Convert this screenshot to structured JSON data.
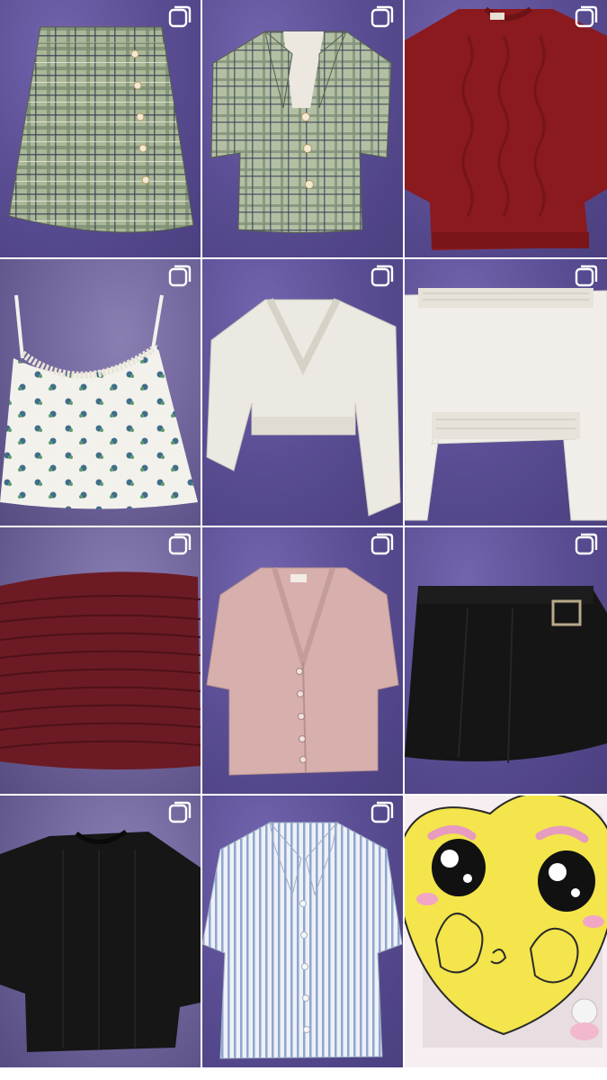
{
  "feed": {
    "posts": [
      {
        "name": "green-plaid-skirt-post",
        "icon": "multiple-photos-icon"
      },
      {
        "name": "green-plaid-shirt-post",
        "icon": "multiple-photos-icon"
      },
      {
        "name": "red-cable-sweater-post",
        "icon": "multiple-photos-icon"
      },
      {
        "name": "floral-cami-post",
        "icon": "multiple-photos-icon"
      },
      {
        "name": "white-vneck-crop-post",
        "icon": "multiple-photos-icon"
      },
      {
        "name": "white-offshoulder-top-post",
        "icon": "multiple-photos-icon"
      },
      {
        "name": "burgundy-smocked-top-post",
        "icon": "multiple-photos-icon"
      },
      {
        "name": "pink-cardigan-post",
        "icon": "multiple-photos-icon"
      },
      {
        "name": "black-buckle-skirt-post",
        "icon": "multiple-photos-icon"
      },
      {
        "name": "black-sweater-post",
        "icon": "multiple-photos-icon"
      },
      {
        "name": "striped-shirt-post",
        "icon": "multiple-photos-icon"
      },
      {
        "name": "cartoon-sticker-post",
        "icon": "none"
      }
    ]
  },
  "colors": {
    "bedsheet_purple": "#5a4d93",
    "plaid_green": "#9aa98a",
    "sweater_red": "#8f1c1f",
    "cream_white": "#efece6",
    "burgundy": "#6a1a22",
    "blush_pink": "#d9b3b0",
    "black": "#141414",
    "stripe_blue": "#8fa6cf",
    "sticker_yellow": "#f4e64a"
  }
}
